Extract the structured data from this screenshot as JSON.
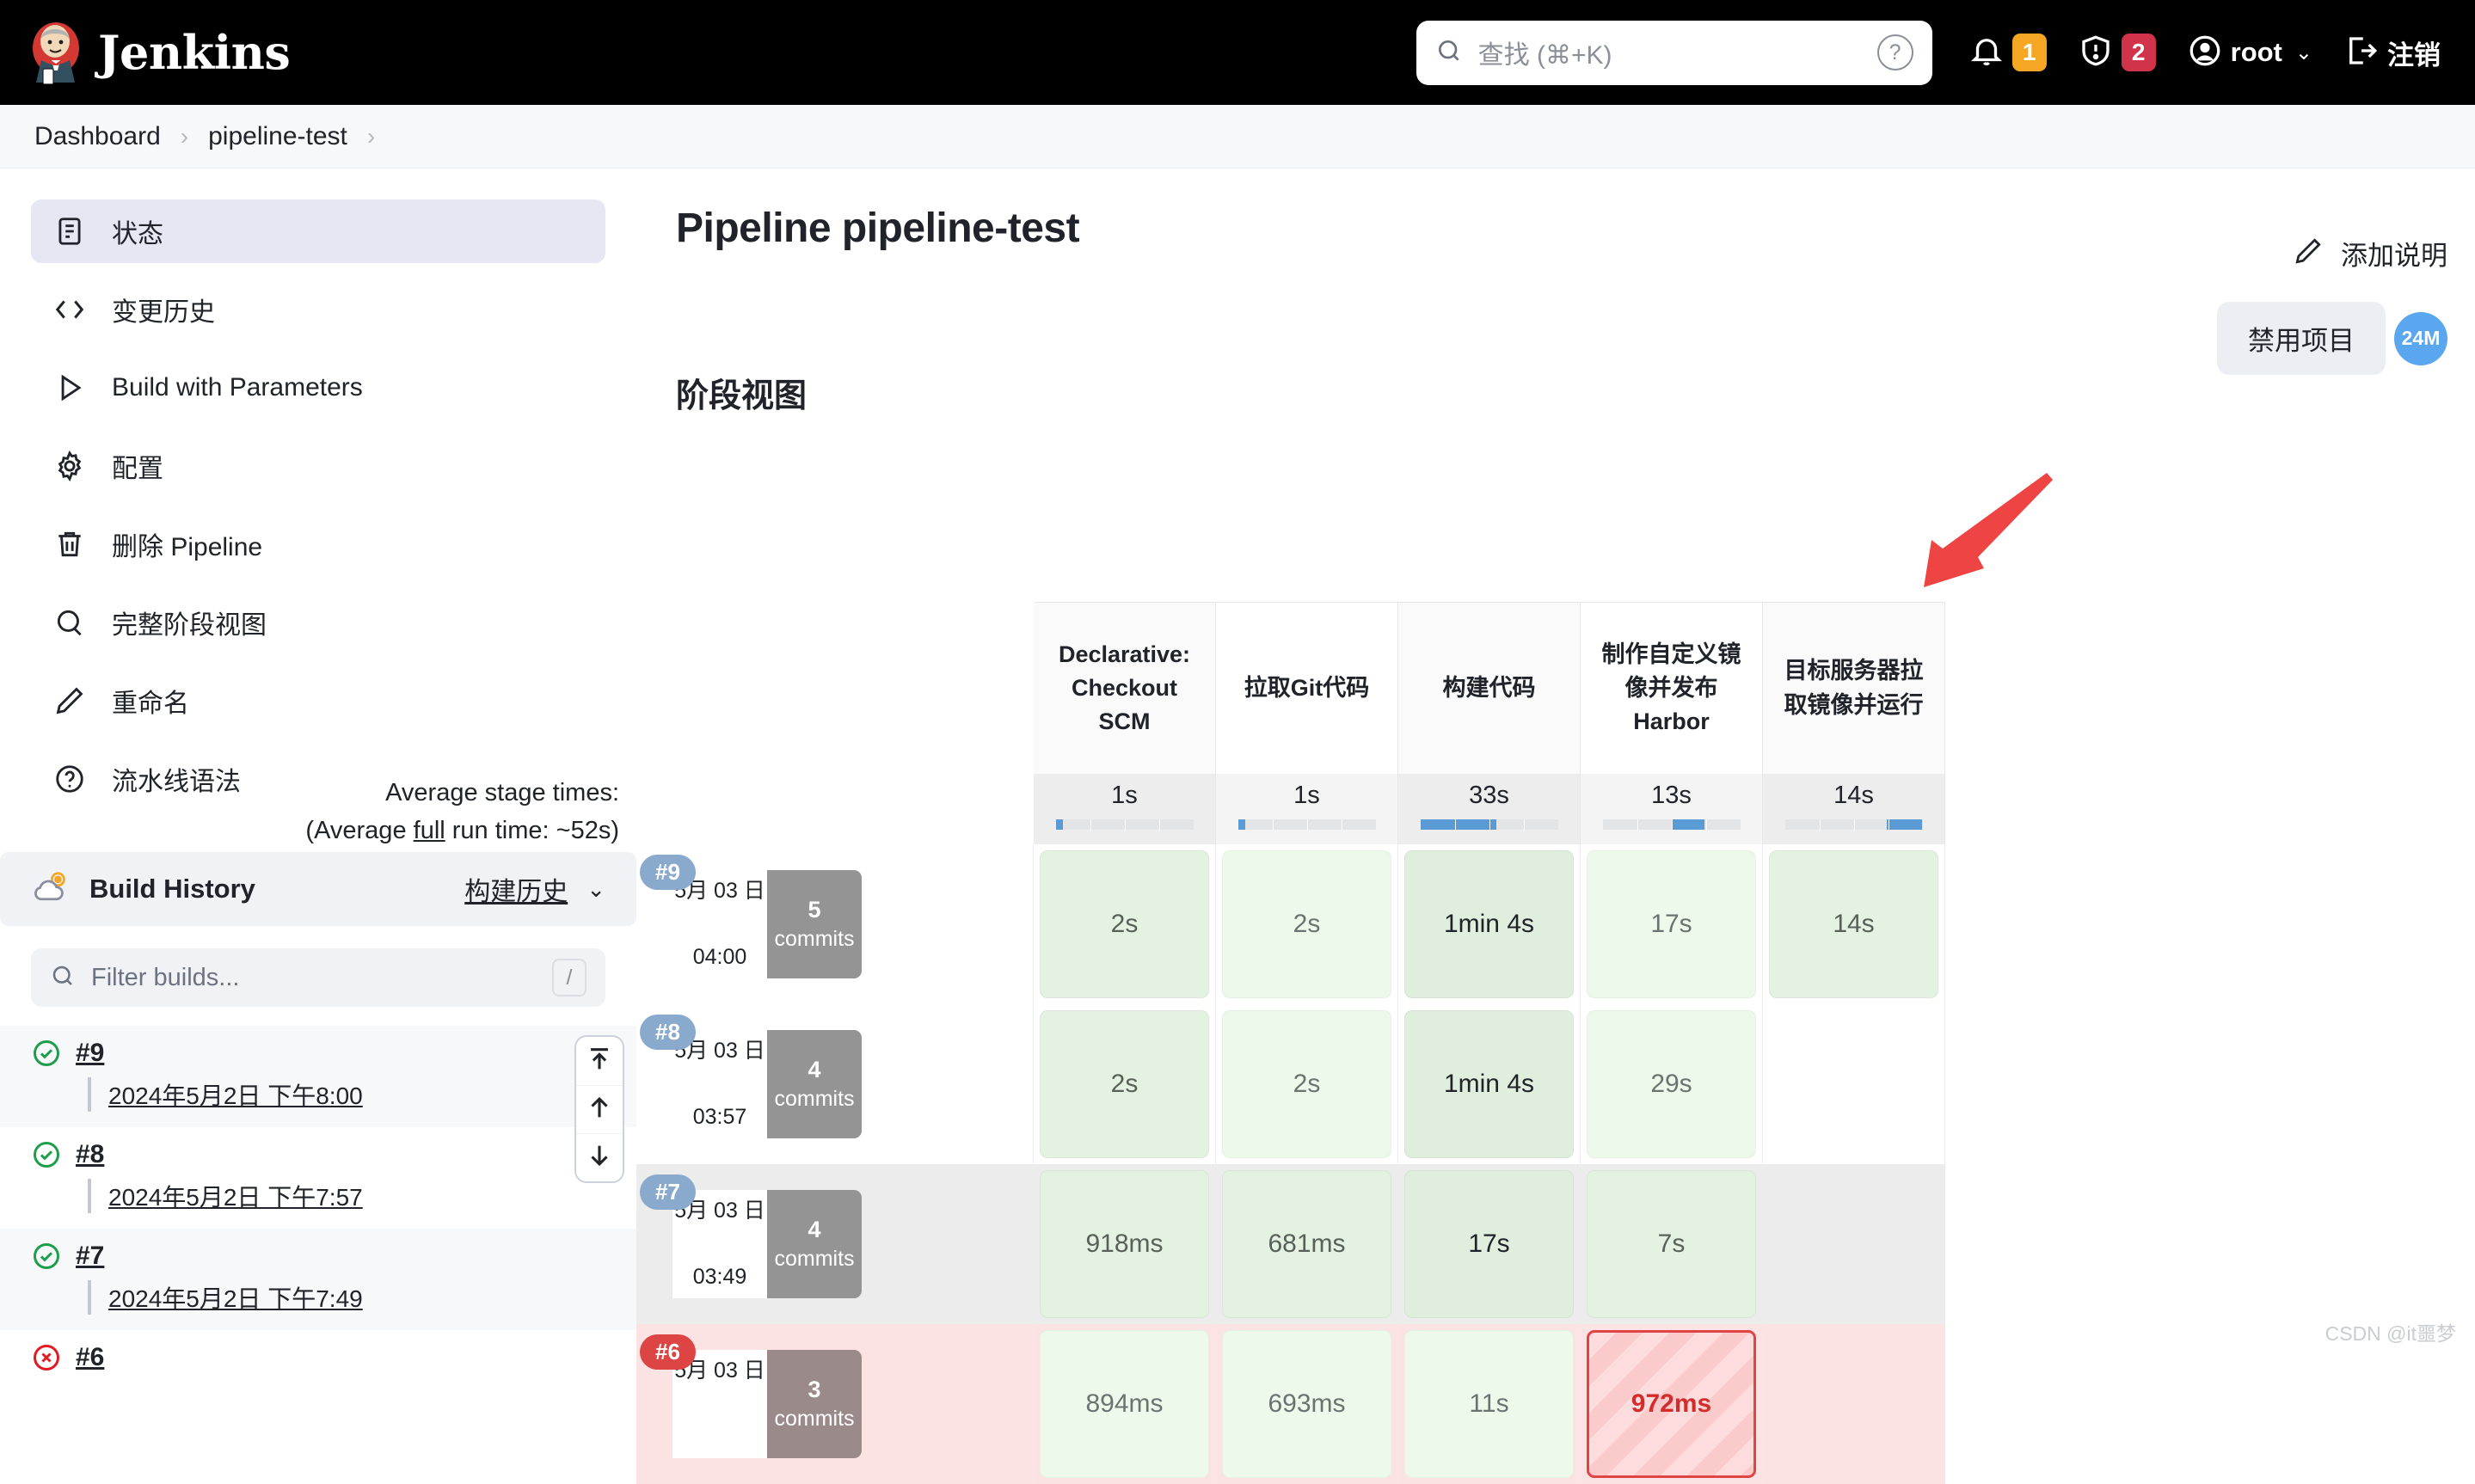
{
  "header": {
    "brand": "Jenkins",
    "logo_icon": "jenkins-butler-logo",
    "search": {
      "placeholder": "查找 (⌘+K)",
      "value": "",
      "icon": "search-icon"
    },
    "help_icon": "help-circle-icon",
    "notifications": {
      "icon": "bell-icon",
      "count": "1",
      "color": "#f5a623"
    },
    "security": {
      "icon": "shield-alert-icon",
      "count": "2",
      "color": "#d1334a"
    },
    "user": {
      "icon": "user-avatar-icon",
      "name": "root",
      "chevron": "chevron-down-icon"
    },
    "logout": {
      "icon": "logout-icon",
      "label": "注销"
    }
  },
  "breadcrumb": {
    "items": [
      "Dashboard",
      "pipeline-test"
    ],
    "separator": "chevron-right-icon"
  },
  "sidebar": {
    "items": [
      {
        "label": "状态",
        "icon": "document-icon",
        "active": true
      },
      {
        "label": "变更历史",
        "icon": "code-icon",
        "active": false
      },
      {
        "label": "Build with Parameters",
        "icon": "play-icon",
        "active": false
      },
      {
        "label": "配置",
        "icon": "gear-icon",
        "active": false
      },
      {
        "label": "删除 Pipeline",
        "icon": "trash-icon",
        "active": false
      },
      {
        "label": "完整阶段视图",
        "icon": "search-icon",
        "active": false
      },
      {
        "label": "重命名",
        "icon": "pencil-icon",
        "active": false
      },
      {
        "label": "流水线语法",
        "icon": "help-circle-icon",
        "active": false
      }
    ],
    "build_history": {
      "weather_icon": "partly-cloudy-icon",
      "title": "Build History",
      "link_label": "构建历史",
      "chevron": "chevron-down-icon",
      "filter_placeholder": "Filter builds...",
      "filter_value": "",
      "filter_shortcut": "/",
      "builds": [
        {
          "id": "#9",
          "date": "2024年5月2日 下午8:00",
          "status": "success",
          "status_icon": "check-circle-icon"
        },
        {
          "id": "#8",
          "date": "2024年5月2日 下午7:57",
          "status": "success",
          "status_icon": "check-circle-icon"
        },
        {
          "id": "#7",
          "date": "2024年5月2日 下午7:49",
          "status": "success",
          "status_icon": "check-circle-icon"
        },
        {
          "id": "#6",
          "date": "",
          "status": "failed",
          "status_icon": "x-circle-icon"
        }
      ]
    }
  },
  "main": {
    "page_title": "Pipeline pipeline-test",
    "section_title": "阶段视图",
    "add_description": {
      "label": "添加说明",
      "icon": "pencil-icon"
    },
    "disable_button": {
      "label": "禁用项目"
    },
    "weather_badge": {
      "label": "24M",
      "color": "#5aa7f0"
    },
    "annotation": {
      "type": "red-arrow",
      "color": "#ef4444"
    },
    "watermark": "CSDN @it噩梦"
  },
  "stage_view": {
    "average_label_line1": "Average stage times:",
    "average_label_line2_pre": "(Average ",
    "average_label_line2_u": "full",
    "average_label_line2_post": " run time: ~52s)",
    "stages": [
      {
        "name": "Declarative: Checkout SCM",
        "avg": "1s",
        "bar_pct": 5
      },
      {
        "name": "拉取Git代码",
        "avg": "1s",
        "bar_pct": 5
      },
      {
        "name": "构建代码",
        "avg": "33s",
        "bar_pct": 55
      },
      {
        "name": "制作自定义镜像并发布Harbor",
        "avg": "13s",
        "bar_pct": 24
      },
      {
        "name": "目标服务器拉取镜像并运行",
        "avg": "14s",
        "bar_pct": 26
      }
    ],
    "runs": [
      {
        "id": "#9",
        "status": "success",
        "date": "5月 03 日",
        "time": "04:00",
        "commits_num": "5",
        "commits_label": "commits",
        "cells": [
          {
            "value": "2s",
            "state": "success-a"
          },
          {
            "value": "2s",
            "state": "success-b"
          },
          {
            "value": "1min 4s",
            "state": "success-dark"
          },
          {
            "value": "17s",
            "state": "success-b"
          },
          {
            "value": "14s",
            "state": "success-a"
          }
        ]
      },
      {
        "id": "#8",
        "status": "success",
        "date": "5月 03 日",
        "time": "03:57",
        "commits_num": "4",
        "commits_label": "commits",
        "cells": [
          {
            "value": "2s",
            "state": "success-a"
          },
          {
            "value": "2s",
            "state": "success-b"
          },
          {
            "value": "1min 4s",
            "state": "success-dark"
          },
          {
            "value": "29s",
            "state": "success-b"
          },
          {
            "value": "",
            "state": "empty"
          }
        ]
      },
      {
        "id": "#7",
        "status": "success",
        "date": "5月 03 日",
        "time": "03:49",
        "commits_num": "4",
        "commits_label": "commits",
        "cells": [
          {
            "value": "918ms",
            "state": "success-a"
          },
          {
            "value": "681ms",
            "state": "success-a"
          },
          {
            "value": "17s",
            "state": "success-dark"
          },
          {
            "value": "7s",
            "state": "success-a"
          },
          {
            "value": "",
            "state": "empty"
          }
        ]
      },
      {
        "id": "#6",
        "status": "failed",
        "date": "5月 03 日",
        "time": "",
        "commits_num": "3",
        "commits_label": "commits",
        "cells": [
          {
            "value": "894ms",
            "state": "success-b"
          },
          {
            "value": "693ms",
            "state": "success-b"
          },
          {
            "value": "11s",
            "state": "success-b"
          },
          {
            "value": "972ms",
            "state": "failed"
          },
          {
            "value": "",
            "state": "empty"
          }
        ]
      }
    ],
    "scroll_buttons": [
      {
        "icon": "jump-to-top-icon",
        "name": "scroll-to-top-button"
      },
      {
        "icon": "arrow-up-icon",
        "name": "scroll-up-button"
      },
      {
        "icon": "arrow-down-icon",
        "name": "scroll-down-button"
      }
    ]
  }
}
